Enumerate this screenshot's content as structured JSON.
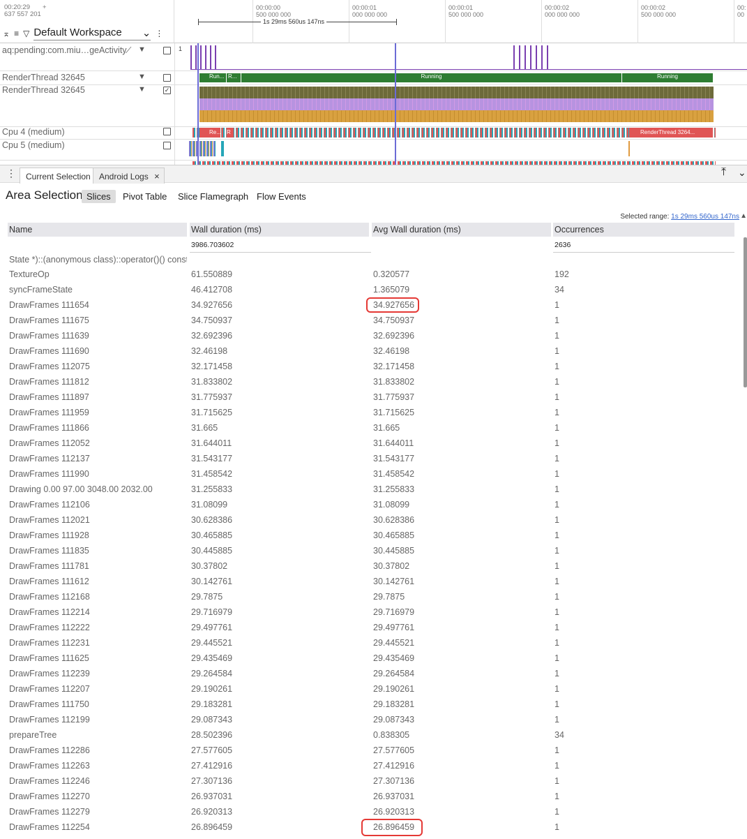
{
  "timeline": {
    "start_time": "00:20:29",
    "start_offset": "637 557 201",
    "plus": "+",
    "workspace": "Default Workspace",
    "ticks": [
      {
        "t": "00:00:00",
        "s": "500 000 000"
      },
      {
        "t": "00:00:01",
        "s": "000 000 000"
      },
      {
        "t": "00:00:01",
        "s": "500 000 000"
      },
      {
        "t": "00:00:02",
        "s": "000 000 000"
      },
      {
        "t": "00:00:02",
        "s": "500 000 000"
      },
      {
        "t": "00:",
        "s": "00"
      }
    ],
    "range_label": "1s 29ms 560us 147ns"
  },
  "tracks": [
    {
      "name": "aq:pending:com.miu…geActivity",
      "count": "1",
      "checked": false
    },
    {
      "name": "RenderThread 32645",
      "checked": false,
      "slices": [
        "Run...",
        "R...",
        "Running",
        "Running"
      ]
    },
    {
      "name": "RenderThread 32645",
      "checked": true
    },
    {
      "name": "Cpu 4 (medium)",
      "checked": false,
      "slices": [
        "Re...",
        "R",
        "RenderThread 3264..."
      ]
    },
    {
      "name": "Cpu 5 (medium)",
      "checked": false
    }
  ],
  "panel": {
    "tabs": [
      "Current Selection",
      "Android Logs"
    ],
    "close": "×",
    "title": "Area Selection",
    "subtabs": [
      "Slices",
      "Pivot Table",
      "Slice Flamegraph",
      "Flow Events"
    ],
    "selected_range_label": "Selected range:",
    "selected_range_value": "1s 29ms 560us 147ns"
  },
  "table": {
    "headers": [
      "Name",
      "Wall duration (ms)",
      "Avg Wall duration (ms)",
      "Occurrences"
    ],
    "totals": {
      "wall": "3986.703602",
      "occ": "2636"
    },
    "partial_row": "State *)::(anonymous class)::operator()() const",
    "rows": [
      [
        "TextureOp",
        "61.550889",
        "0.320577",
        "192"
      ],
      [
        "syncFrameState",
        "46.412708",
        "1.365079",
        "34"
      ],
      [
        "DrawFrames 111654",
        "34.927656",
        "34.927656",
        "1"
      ],
      [
        "DrawFrames 111675",
        "34.750937",
        "34.750937",
        "1"
      ],
      [
        "DrawFrames 111639",
        "32.692396",
        "32.692396",
        "1"
      ],
      [
        "DrawFrames 111690",
        "32.46198",
        "32.46198",
        "1"
      ],
      [
        "DrawFrames 112075",
        "32.171458",
        "32.171458",
        "1"
      ],
      [
        "DrawFrames 111812",
        "31.833802",
        "31.833802",
        "1"
      ],
      [
        "DrawFrames 111897",
        "31.775937",
        "31.775937",
        "1"
      ],
      [
        "DrawFrames 111959",
        "31.715625",
        "31.715625",
        "1"
      ],
      [
        "DrawFrames 111866",
        "31.665",
        "31.665",
        "1"
      ],
      [
        "DrawFrames 112052",
        "31.644011",
        "31.644011",
        "1"
      ],
      [
        "DrawFrames 112137",
        "31.543177",
        "31.543177",
        "1"
      ],
      [
        "DrawFrames 111990",
        "31.458542",
        "31.458542",
        "1"
      ],
      [
        "Drawing 0.00 97.00 3048.00 2032.00",
        "31.255833",
        "31.255833",
        "1"
      ],
      [
        "DrawFrames 112106",
        "31.08099",
        "31.08099",
        "1"
      ],
      [
        "DrawFrames 112021",
        "30.628386",
        "30.628386",
        "1"
      ],
      [
        "DrawFrames 111928",
        "30.465885",
        "30.465885",
        "1"
      ],
      [
        "DrawFrames 111835",
        "30.445885",
        "30.445885",
        "1"
      ],
      [
        "DrawFrames 111781",
        "30.37802",
        "30.37802",
        "1"
      ],
      [
        "DrawFrames 111612",
        "30.142761",
        "30.142761",
        "1"
      ],
      [
        "DrawFrames 112168",
        "29.7875",
        "29.7875",
        "1"
      ],
      [
        "DrawFrames 112214",
        "29.716979",
        "29.716979",
        "1"
      ],
      [
        "DrawFrames 112222",
        "29.497761",
        "29.497761",
        "1"
      ],
      [
        "DrawFrames 112231",
        "29.445521",
        "29.445521",
        "1"
      ],
      [
        "DrawFrames 111625",
        "29.435469",
        "29.435469",
        "1"
      ],
      [
        "DrawFrames 112239",
        "29.264584",
        "29.264584",
        "1"
      ],
      [
        "DrawFrames 112207",
        "29.190261",
        "29.190261",
        "1"
      ],
      [
        "DrawFrames 111750",
        "29.183281",
        "29.183281",
        "1"
      ],
      [
        "DrawFrames 112199",
        "29.087343",
        "29.087343",
        "1"
      ],
      [
        "prepareTree",
        "28.502396",
        "0.838305",
        "34"
      ],
      [
        "DrawFrames 112286",
        "27.577605",
        "27.577605",
        "1"
      ],
      [
        "DrawFrames 112263",
        "27.412916",
        "27.412916",
        "1"
      ],
      [
        "DrawFrames 112246",
        "27.307136",
        "27.307136",
        "1"
      ],
      [
        "DrawFrames 112270",
        "26.937031",
        "26.937031",
        "1"
      ],
      [
        "DrawFrames 112279",
        "26.920313",
        "26.920313",
        "1"
      ],
      [
        "DrawFrames 112254",
        "26.896459",
        "26.896459",
        "1"
      ]
    ],
    "highlight_color": "#e53935"
  }
}
